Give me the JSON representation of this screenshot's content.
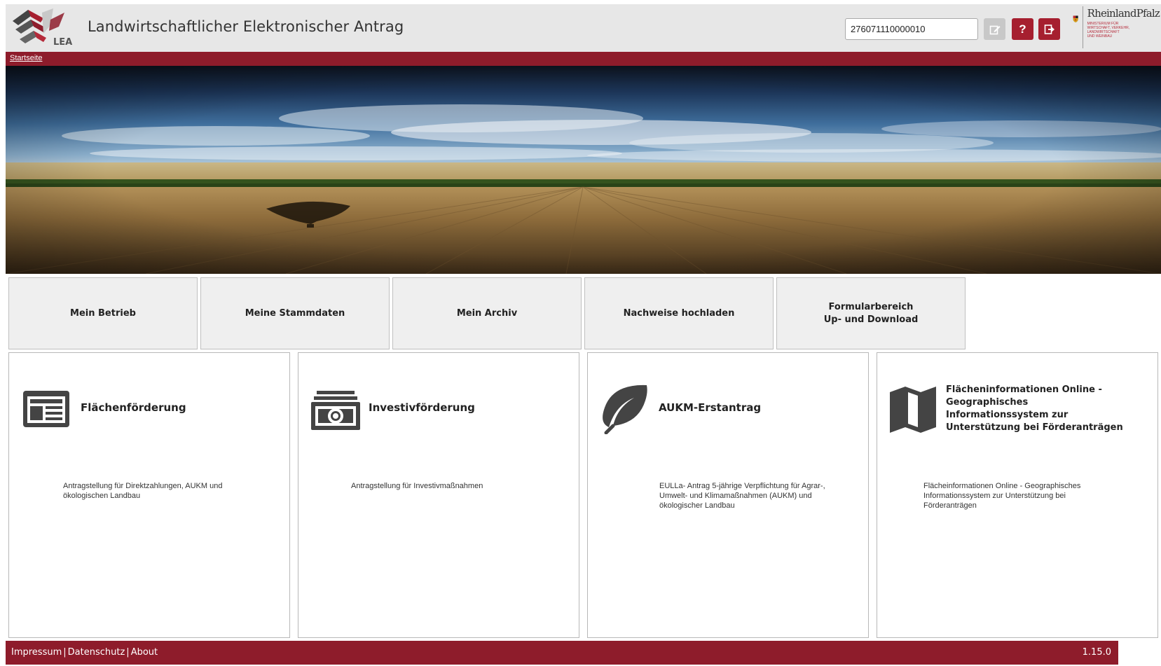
{
  "header": {
    "app_title": "Landwirtschaftlicher Elektronischer Antrag",
    "logo_text": "LEA",
    "client_number": "276071110000010",
    "help_label": "?",
    "state_logo_name": "RheinlandPfalz",
    "state_logo_sub": "MINISTERIUM FÜR\nWIRTSCHAFT, VERKEHR,\nLANDWIRTSCHAFT\nUND WEINBAU"
  },
  "breadcrumb": {
    "home": "Startseite"
  },
  "tiles": [
    {
      "label": "Mein Betrieb"
    },
    {
      "label": "Meine Stammdaten"
    },
    {
      "label": "Mein Archiv"
    },
    {
      "label": "Nachweise hochladen"
    },
    {
      "label": "Formularbereich\nUp- und Download"
    }
  ],
  "cards": [
    {
      "icon": "newspaper-icon",
      "title": "Flächenförderung",
      "description": "Antragstellung für Direktzahlungen, AUKM und\nökologischen Landbau"
    },
    {
      "icon": "money-icon",
      "title": "Investivförderung",
      "description": "Antragstellung für Investivmaßnahmen"
    },
    {
      "icon": "leaf-icon",
      "title": "AUKM-Erstantrag",
      "description": "EULLa- Antrag 5-jährige Verpflichtung für Agrar-,\nUmwelt- und Klimamaßnahmen (AUKM) und\nökologischer Landbau"
    },
    {
      "icon": "map-icon",
      "title": "Flächeninformationen Online -\nGeographisches\nInformationssystem zur\nUnterstützung bei Förderanträgen",
      "description": "Flächeinformationen Online - Geographisches\nInformationssystem zur Unterstützung bei\nFörderanträgen"
    }
  ],
  "footer": {
    "links": [
      "Impressum",
      "Datenschutz",
      "About"
    ],
    "separator": "|",
    "version": "1.15.0"
  },
  "colors": {
    "brand_red": "#8e1c2b",
    "button_red": "#a61f2f",
    "header_bg": "#e7e7e7",
    "tile_bg": "#efefef"
  }
}
